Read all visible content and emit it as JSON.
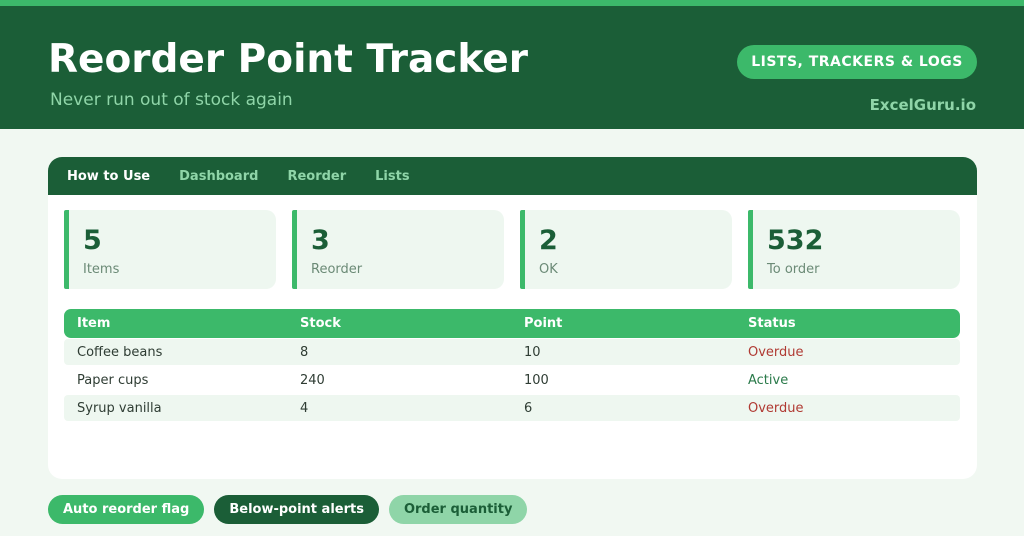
{
  "header": {
    "title": "Reorder Point Tracker",
    "subtitle": "Never run out of stock again",
    "category": "LISTS, TRACKERS & LOGS",
    "brand": "ExcelGuru.io"
  },
  "tabs": [
    "How to Use",
    "Dashboard",
    "Reorder",
    "Lists"
  ],
  "stats": [
    {
      "value": "5",
      "label": "Items"
    },
    {
      "value": "3",
      "label": "Reorder"
    },
    {
      "value": "2",
      "label": "OK"
    },
    {
      "value": "532",
      "label": "To order"
    }
  ],
  "table": {
    "headers": [
      "Item",
      "Stock",
      "Point",
      "Status"
    ],
    "rows": [
      {
        "item": "Coffee beans",
        "stock": "8",
        "point": "10",
        "status": "Overdue"
      },
      {
        "item": "Paper cups",
        "stock": "240",
        "point": "100",
        "status": "Active"
      },
      {
        "item": "Syrup vanilla",
        "stock": "4",
        "point": "6",
        "status": "Overdue"
      }
    ]
  },
  "chips": [
    "Auto reorder flag",
    "Below-point alerts",
    "Order quantity"
  ],
  "colors": {
    "dark_green": "#1b5e37",
    "accent_green": "#3cb96a",
    "light_green": "#8fd5a8",
    "overdue_red": "#b03a33"
  }
}
